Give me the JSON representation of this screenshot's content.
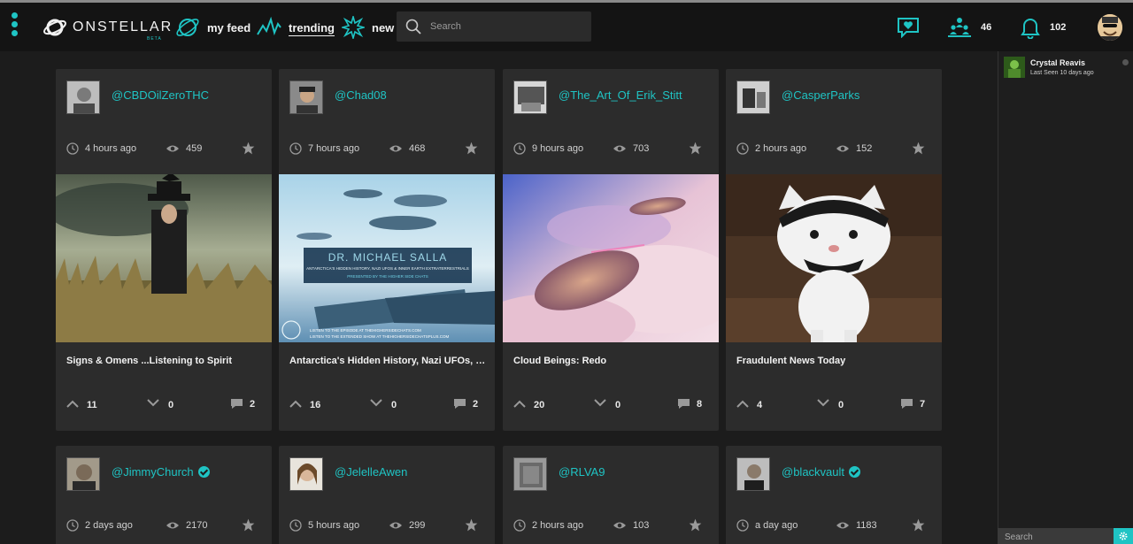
{
  "app": {
    "logo_text": "ONSTELLAR",
    "logo_badge": "BETA"
  },
  "nav": {
    "feed": "my feed",
    "trending": "trending",
    "new": "new",
    "search_placeholder": "Search",
    "hearts_icon": "heart-chat-icon",
    "connections_count": "46",
    "notifications_count": "102"
  },
  "colors": {
    "accent": "#1fc4c4",
    "background": "#1c1c1c",
    "card": "#2c2c2c",
    "topbar": "#141414"
  },
  "cards": [
    {
      "handle": "@CBDOilZeroTHC",
      "verified": false,
      "time": "4 hours ago",
      "views": "459",
      "title": "Signs & Omens ...Listening to Spirit",
      "up": "11",
      "down": "0",
      "comments": "2"
    },
    {
      "handle": "@Chad08",
      "verified": false,
      "time": "7 hours ago",
      "views": "468",
      "title": "Antarctica's Hidden History, Nazi UFOs, & Inn...",
      "up": "16",
      "down": "0",
      "comments": "2",
      "overlay": {
        "name": "DR. MICHAEL SALLA",
        "subtitle": "ANTARCTICA'S HIDDEN HISTORY, NAZI UFOS & INNER EARTH EXTRATERRESTRIALS",
        "presented": "PRESENTED BY THE HIGHER SIDE CHATS",
        "line1": "LISTEN TO THE EPISODE AT THEHIGHERSIDECHATS.COM",
        "line2": "LISTEN TO THE EXTENDED SHOW AT THEHIGHERSIDECHATSPLUS.COM"
      }
    },
    {
      "handle": "@The_Art_Of_Erik_Stitt",
      "verified": false,
      "time": "9 hours ago",
      "views": "703",
      "title": "Cloud Beings: Redo",
      "up": "20",
      "down": "0",
      "comments": "8"
    },
    {
      "handle": "@CasperParks",
      "verified": false,
      "time": "2 hours ago",
      "views": "152",
      "title": "Fraudulent News Today",
      "up": "4",
      "down": "0",
      "comments": "7"
    },
    {
      "handle": "@JimmyChurch",
      "verified": true,
      "time": "2 days ago",
      "views": "2170"
    },
    {
      "handle": "@JelelleAwen",
      "verified": false,
      "time": "5 hours ago",
      "views": "299"
    },
    {
      "handle": "@RLVA9",
      "verified": false,
      "time": "2 hours ago",
      "views": "103"
    },
    {
      "handle": "@blackvault",
      "verified": true,
      "time": "a day ago",
      "views": "1183"
    }
  ],
  "sidebar": {
    "friend_name": "Crystal Reavis",
    "friend_seen": "Last Seen 10 days ago",
    "search_placeholder": "Search"
  }
}
